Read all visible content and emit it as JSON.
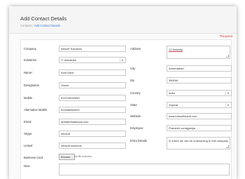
{
  "header": {
    "title": "Add Contact Details",
    "breadcrumb_home": "Contacts",
    "breadcrumb_sep": "/",
    "breadcrumb_current": "Add Contact Details"
  },
  "required_note": "*Required",
  "left": {
    "company": {
      "label": "Company",
      "value": "inifoa® Solutions"
    },
    "industries": {
      "label": "Industries",
      "value": "IT Industries"
    },
    "name": {
      "label": "Name",
      "required": "*",
      "value": "Amit Dave"
    },
    "designation": {
      "label": "Designation",
      "value": "Owner"
    },
    "mobile": {
      "label": "Mobile",
      "value": "919726632550"
    },
    "alt_mobile": {
      "label": "Alternative Mobile",
      "value": "919448852592"
    },
    "email": {
      "label": "Email",
      "value": "amit@infoafsucal.com"
    },
    "skype": {
      "label": "Skype",
      "value": "infosoft"
    },
    "linked": {
      "label": "Linked",
      "value": "infosoft solutions"
    },
    "business_card": {
      "label": "Business Card",
      "button": "Browse...",
      "status": "No file selected."
    },
    "note": {
      "label": "Note",
      "value": ""
    }
  },
  "right": {
    "address": {
      "label": "Address",
      "value": "12,Satecity"
    },
    "city": {
      "label": "City",
      "value": "Ahmedabad"
    },
    "zip": {
      "label": "Zip",
      "value": "380006"
    },
    "country": {
      "label": "Country",
      "value": "India"
    },
    "state": {
      "label": "State",
      "value": "Gujarat"
    },
    "website": {
      "label": "Website",
      "value": "www.infosoftsucal.com"
    },
    "employee": {
      "label": "Employee",
      "value": "Pramesh currajgariya"
    },
    "extra_details": {
      "label": "Extra Details",
      "value": "In future we can do outsourcing to this company"
    }
  },
  "colors": {
    "accent": "#3a7bd5",
    "required": "#d23a3a",
    "primary_button": "#3a7bd5"
  }
}
